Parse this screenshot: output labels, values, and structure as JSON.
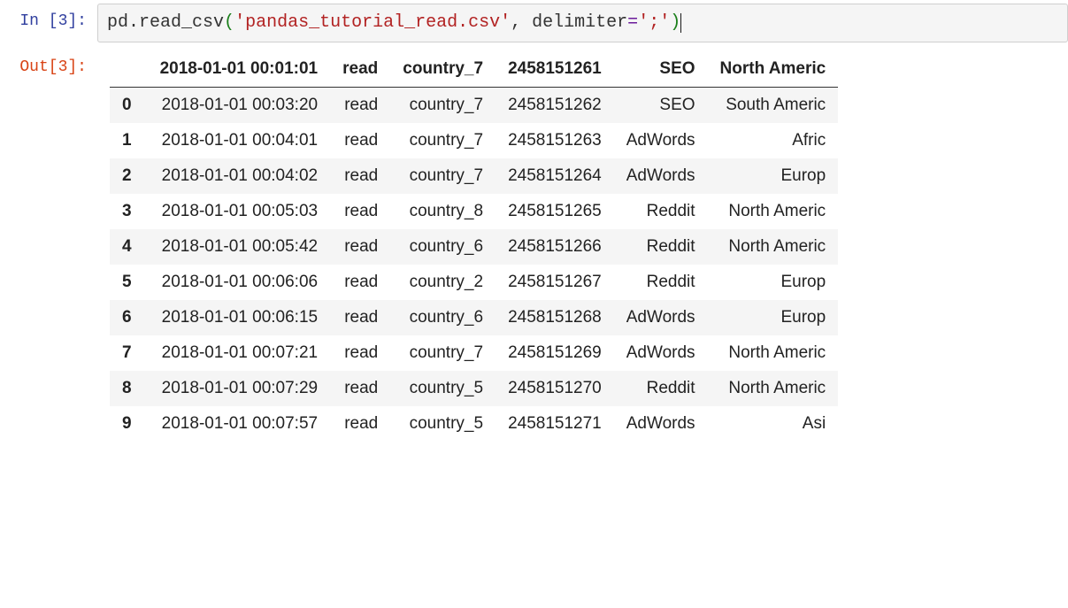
{
  "input_prompt": "In [3]:",
  "output_prompt": "Out[3]:",
  "code": {
    "obj": "pd",
    "dot": ".",
    "func": "read_csv",
    "lparen": "(",
    "str": "'pandas_tutorial_read.csv'",
    "comma_sp": ", ",
    "kw": "delimiter",
    "eq": "=",
    "str2": "';'",
    "rparen": ")"
  },
  "table": {
    "headers": [
      "",
      "2018-01-01 00:01:01",
      "read",
      "country_7",
      "2458151261",
      "SEO",
      "North Americ"
    ],
    "rows": [
      {
        "idx": "0",
        "cells": [
          "2018-01-01 00:03:20",
          "read",
          "country_7",
          "2458151262",
          "SEO",
          "South Americ"
        ]
      },
      {
        "idx": "1",
        "cells": [
          "2018-01-01 00:04:01",
          "read",
          "country_7",
          "2458151263",
          "AdWords",
          "Afric"
        ]
      },
      {
        "idx": "2",
        "cells": [
          "2018-01-01 00:04:02",
          "read",
          "country_7",
          "2458151264",
          "AdWords",
          "Europ"
        ]
      },
      {
        "idx": "3",
        "cells": [
          "2018-01-01 00:05:03",
          "read",
          "country_8",
          "2458151265",
          "Reddit",
          "North Americ"
        ]
      },
      {
        "idx": "4",
        "cells": [
          "2018-01-01 00:05:42",
          "read",
          "country_6",
          "2458151266",
          "Reddit",
          "North Americ"
        ]
      },
      {
        "idx": "5",
        "cells": [
          "2018-01-01 00:06:06",
          "read",
          "country_2",
          "2458151267",
          "Reddit",
          "Europ"
        ]
      },
      {
        "idx": "6",
        "cells": [
          "2018-01-01 00:06:15",
          "read",
          "country_6",
          "2458151268",
          "AdWords",
          "Europ"
        ]
      },
      {
        "idx": "7",
        "cells": [
          "2018-01-01 00:07:21",
          "read",
          "country_7",
          "2458151269",
          "AdWords",
          "North Americ"
        ]
      },
      {
        "idx": "8",
        "cells": [
          "2018-01-01 00:07:29",
          "read",
          "country_5",
          "2458151270",
          "Reddit",
          "North Americ"
        ]
      },
      {
        "idx": "9",
        "cells": [
          "2018-01-01 00:07:57",
          "read",
          "country_5",
          "2458151271",
          "AdWords",
          "Asi"
        ]
      }
    ]
  }
}
